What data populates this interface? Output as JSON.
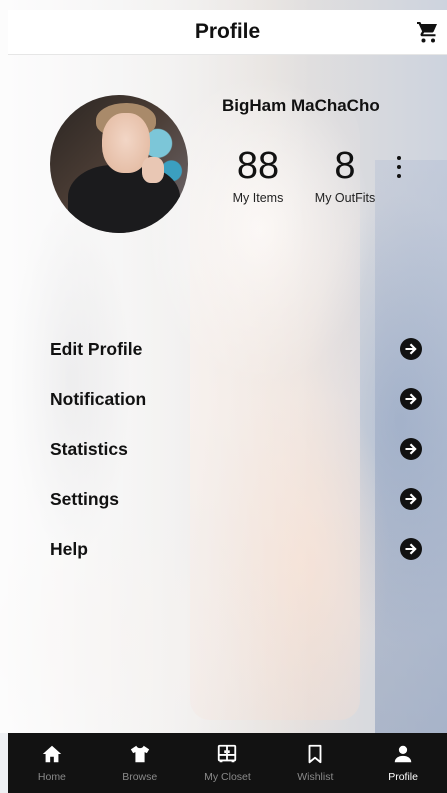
{
  "header": {
    "title": "Profile",
    "cart_icon": "shopping-cart-icon"
  },
  "profile": {
    "name": "BigHam MaChaCho",
    "items_count": "88",
    "items_label": "My Items",
    "outfits_count": "8",
    "outfits_label": "My OutFits"
  },
  "menu": {
    "items": [
      {
        "label": "Edit Profile",
        "icon": "arrow-right-circle-icon"
      },
      {
        "label": "Notification",
        "icon": "arrow-right-circle-icon"
      },
      {
        "label": "Statistics",
        "icon": "arrow-right-circle-icon"
      },
      {
        "label": "Settings",
        "icon": "arrow-right-circle-icon"
      },
      {
        "label": "Help",
        "icon": "arrow-right-circle-icon"
      }
    ]
  },
  "nav": {
    "active": "Profile",
    "items": [
      {
        "label": "Home",
        "icon": "home-icon"
      },
      {
        "label": "Browse",
        "icon": "shirt-icon"
      },
      {
        "label": "My Closet",
        "icon": "closet-icon"
      },
      {
        "label": "Wishlist",
        "icon": "bookmark-icon"
      },
      {
        "label": "Profile",
        "icon": "person-icon"
      }
    ]
  },
  "colors": {
    "navbar": "#121212",
    "nav_active": "#ffffff",
    "nav_inactive": "#8a8a8a",
    "text": "#111111"
  }
}
